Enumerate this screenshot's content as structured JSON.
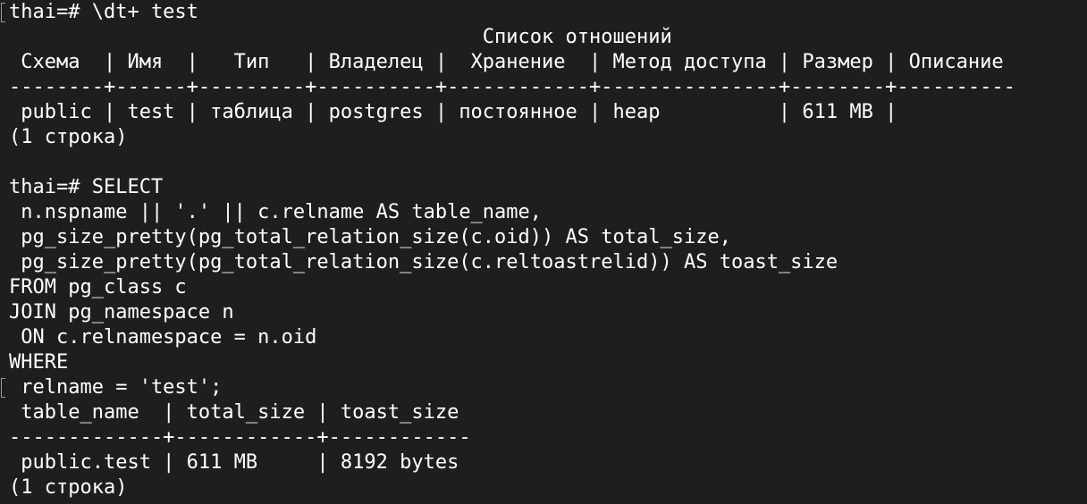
{
  "terminal": {
    "background": "#1e1e1e",
    "foreground": "#ffffff",
    "marker_color": "#9a9a9a",
    "lines": [
      "thai=# \\dt+ test",
      "                                        Список отношений",
      " Схема  | Имя  |   Тип   | Владелец |  Хранение  | Метод доступа | Размер | Описание",
      "--------+------+---------+----------+------------+---------------+--------+----------",
      " public | test | таблица | postgres | постоянное | heap          | 611 MB |",
      "(1 строка)",
      "",
      "thai=# SELECT",
      " n.nspname || '.' || c.relname AS table_name,",
      " pg_size_pretty(pg_total_relation_size(c.oid)) AS total_size,",
      " pg_size_pretty(pg_total_relation_size(c.reltoastrelid)) AS toast_size",
      "FROM pg_class c",
      "JOIN pg_namespace n",
      " ON c.relnamespace = n.oid",
      "WHERE",
      " relname = 'test';",
      " table_name  | total_size | toast_size",
      "-------------+------------+------------",
      " public.test | 611 MB     | 8192 bytes",
      "(1 строка)"
    ]
  }
}
